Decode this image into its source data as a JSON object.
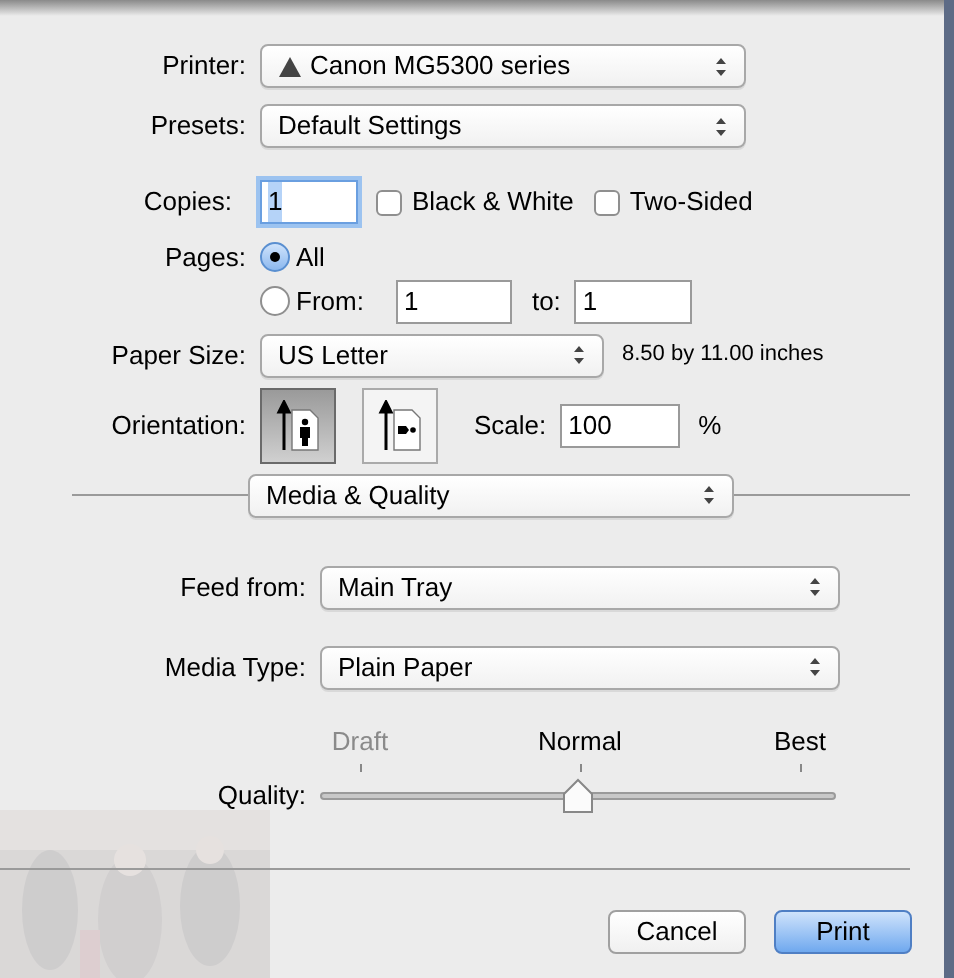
{
  "printer": {
    "label": "Printer:",
    "value": "Canon MG5300 series",
    "warning": true
  },
  "presets": {
    "label": "Presets:",
    "value": "Default Settings"
  },
  "copies": {
    "label": "Copies:",
    "value": "1",
    "focused": true
  },
  "options": [
    {
      "label": "Black & White",
      "checked": false
    },
    {
      "label": "Two-Sided",
      "checked": false
    }
  ],
  "pages": {
    "label": "Pages:",
    "choices": [
      {
        "label": "All",
        "selected": true
      },
      {
        "label": "From:",
        "selected": false
      }
    ],
    "from": "1",
    "to_label": "to:",
    "to": "1"
  },
  "paper_size": {
    "label": "Paper Size:",
    "value": "US Letter",
    "dimensions": "8.50 by 11.00 inches"
  },
  "orientation": {
    "label": "Orientation:",
    "choices": [
      {
        "kind": "portrait",
        "selected": true
      },
      {
        "kind": "landscape",
        "selected": false
      }
    ]
  },
  "scale": {
    "label": "Scale:",
    "value": "100",
    "unit": "%"
  },
  "section": {
    "value": "Media & Quality"
  },
  "feed_from": {
    "label": "Feed from:",
    "value": "Main Tray"
  },
  "media_type": {
    "label": "Media Type:",
    "value": "Plain Paper"
  },
  "quality": {
    "label": "Quality:",
    "level": 0.5,
    "stops": [
      {
        "label": "Draft",
        "disabled": true
      },
      {
        "label": "Normal",
        "disabled": false
      },
      {
        "label": "Best",
        "disabled": false
      }
    ]
  },
  "buttons": [
    {
      "label": "Cancel",
      "default": false
    },
    {
      "label": "Print",
      "default": true
    }
  ]
}
